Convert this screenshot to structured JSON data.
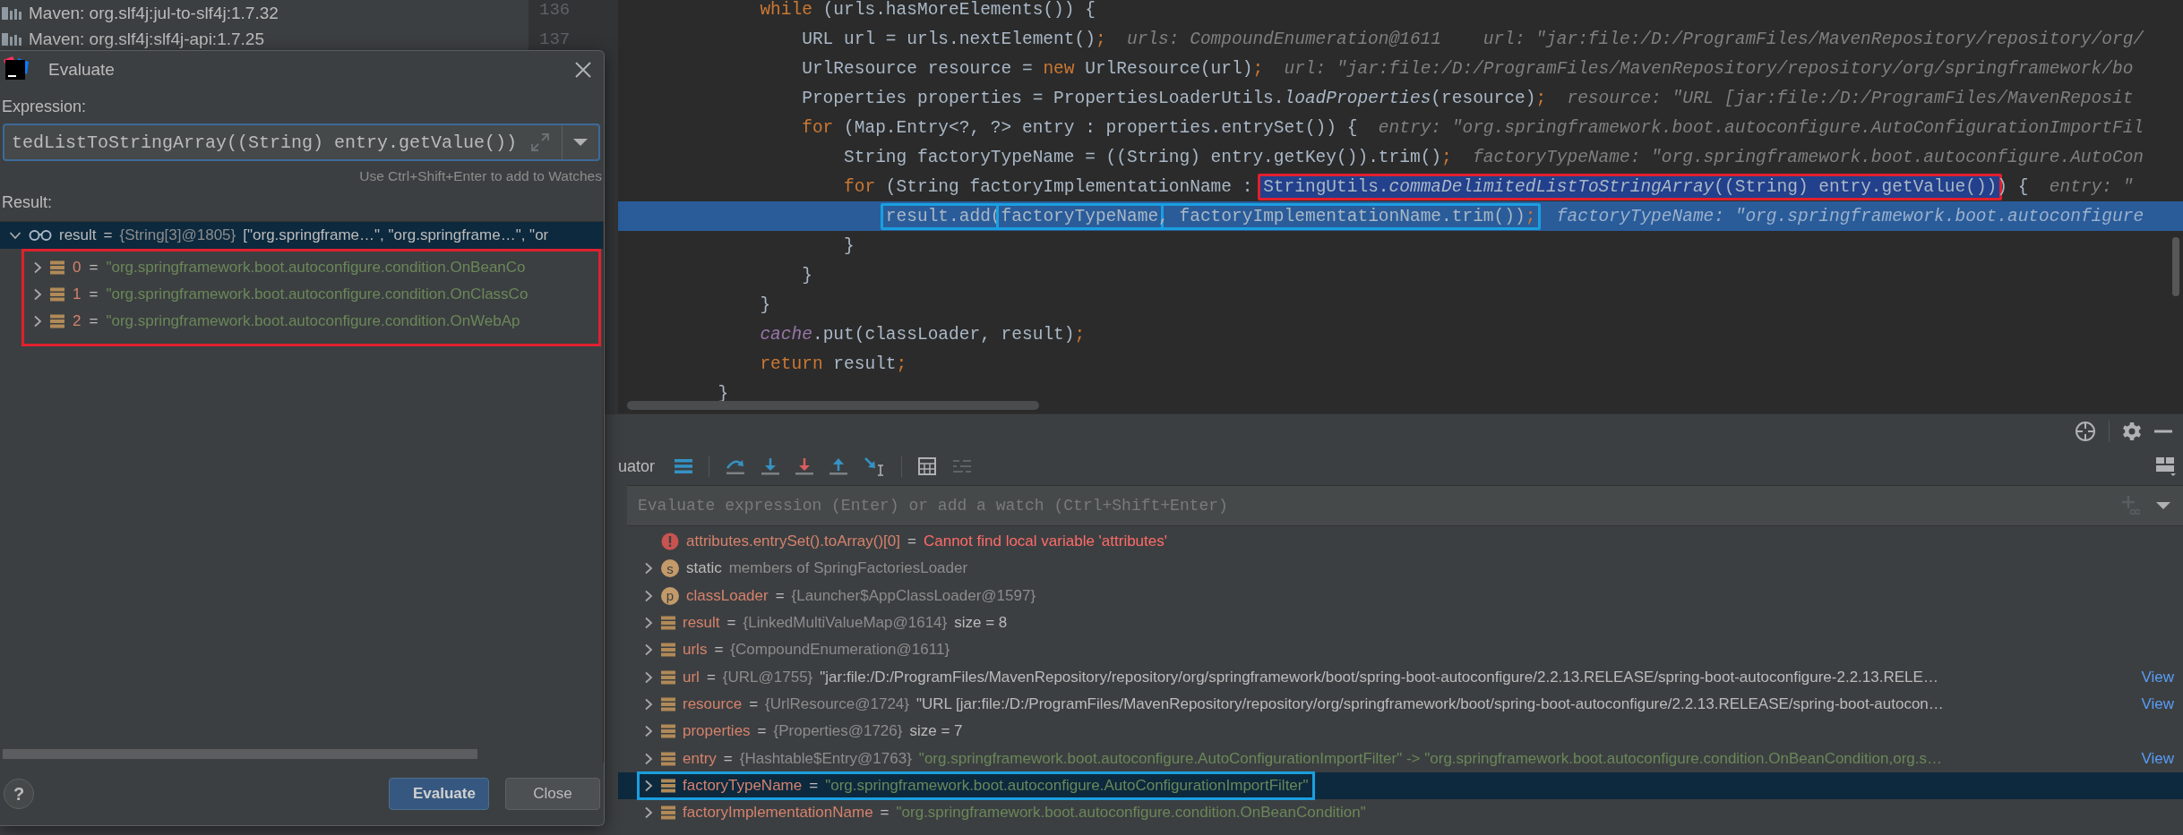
{
  "project_tree": {
    "items": [
      {
        "label": "Maven: org.slf4j:jul-to-slf4j:1.7.32"
      },
      {
        "label": "Maven: org.slf4j:slf4j-api:1.7.25"
      }
    ]
  },
  "editor": {
    "lines": [
      {
        "number": "136",
        "current": false,
        "code": [
          {
            "kind": "keyword",
            "text": "            while"
          },
          {
            "kind": "plain",
            "text": " (urls.hasMoreElements()) {"
          }
        ]
      },
      {
        "number": "137",
        "current": false,
        "code": [
          {
            "kind": "plain",
            "text": "                URL url = urls.nextElement()"
          },
          {
            "kind": "semicolon",
            "text": ";"
          }
        ],
        "hints": [
          "urls: CompoundEnumeration@1611",
          "url: \"jar:file:/D:/ProgramFiles/MavenRepository/repository/org/"
        ]
      },
      {
        "current": false,
        "code": [
          {
            "kind": "plain",
            "text": "                UrlResource resource = "
          },
          {
            "kind": "keyword",
            "text": "new"
          },
          {
            "kind": "plain",
            "text": " UrlResource(url)"
          },
          {
            "kind": "semicolon",
            "text": ";"
          }
        ],
        "hints": [
          "url: \"jar:file:/D:/ProgramFiles/MavenRepository/repository/org/springframework/bo"
        ]
      },
      {
        "current": false,
        "code": [
          {
            "kind": "plain",
            "text": "                Properties properties = PropertiesLoaderUtils."
          },
          {
            "kind": "italic",
            "text": "loadProperties"
          },
          {
            "kind": "plain",
            "text": "(resource)"
          },
          {
            "kind": "semicolon",
            "text": ";"
          }
        ],
        "hints": [
          "resource: \"URL [jar:file:/D:/ProgramFiles/MavenReposit"
        ]
      },
      {
        "current": false,
        "code": [
          {
            "kind": "keyword",
            "text": "                for"
          },
          {
            "kind": "plain",
            "text": " (Map.Entry<?, ?> entry : properties.entrySet()) {"
          }
        ],
        "hints": [
          "entry: \"org.springframework.boot.autoconfigure.AutoConfigurationImportFil"
        ]
      },
      {
        "current": false,
        "code": [
          {
            "kind": "plain",
            "text": "                    String factoryTypeName = ((String) entry.getKey()).trim()"
          },
          {
            "kind": "semicolon",
            "text": ";"
          }
        ],
        "hints": [
          "factoryTypeName: \"org.springframework.boot.autoconfigure.AutoCon"
        ]
      },
      {
        "current": false,
        "code": [
          {
            "kind": "keyword",
            "text": "                    for"
          },
          {
            "kind": "plain",
            "text": " (String factoryImplementationName : "
          },
          {
            "kind": "box",
            "color": "#e0202e",
            "selected": true,
            "tokens": [
              {
                "kind": "plain",
                "text": "StringUtils."
              },
              {
                "kind": "italic",
                "text": "commaDelimitedListToStringArray"
              },
              {
                "kind": "plain",
                "text": "((String) entry.getValue())"
              }
            ]
          },
          {
            "kind": "plain",
            "text": ") {"
          }
        ],
        "hints": [
          "entry: \""
        ]
      },
      {
        "current": true,
        "code": [
          {
            "kind": "box",
            "color": "#1a9fe0",
            "selected": false,
            "tokens": [
              {
                "kind": "plain",
                "text": "                        result.add("
              },
              {
                "kind": "box",
                "color": "#1a9fe0",
                "selected": false,
                "tokens": [
                  {
                    "kind": "plain",
                    "text": "factoryTypeName"
                  }
                ]
              },
              {
                "kind": "plain",
                "text": ", factoryImplementationName.trim())"
              },
              {
                "kind": "semicolon",
                "text": ";"
              }
            ]
          }
        ],
        "hints": [
          "factoryTypeName: \"org.springframework.boot.autoconfigure"
        ]
      },
      {
        "current": false,
        "code": [
          {
            "kind": "plain",
            "text": "                    }"
          }
        ]
      },
      {
        "current": false,
        "code": [
          {
            "kind": "plain",
            "text": "                }"
          }
        ]
      },
      {
        "current": false,
        "code": [
          {
            "kind": "plain",
            "text": "            }"
          }
        ]
      },
      {
        "current": false,
        "code": [
          {
            "kind": "static_field",
            "text": "            cache"
          },
          {
            "kind": "plain",
            "text": ".put(classLoader, result)"
          },
          {
            "kind": "semicolon",
            "text": ";"
          }
        ]
      },
      {
        "current": false,
        "code": [
          {
            "kind": "keyword",
            "text": "            return"
          },
          {
            "kind": "plain",
            "text": " result"
          },
          {
            "kind": "semicolon",
            "text": ";"
          }
        ]
      },
      {
        "current": false,
        "code": [
          {
            "kind": "plain",
            "text": "        }"
          }
        ]
      }
    ]
  },
  "debugger": {
    "tab": "uator",
    "watch_field": {
      "placeholder": "Evaluate expression (Enter) or add a watch (Ctrl+Shift+Enter)"
    },
    "variables": [
      {
        "kind": "error",
        "name": "attributes.entrySet().toArray()[0]",
        "sign": "=",
        "value": "Cannot find local variable 'attributes'",
        "expandable": false,
        "selected": false,
        "boxed": false
      },
      {
        "kind": "static",
        "badge": "s",
        "name": "static",
        "value": "members of SpringFactoriesLoader",
        "expandable": true,
        "selected": false,
        "boxed": false
      },
      {
        "kind": "field",
        "badge": "p",
        "name": "classLoader",
        "sign": "=",
        "type": "{Launcher$AppClassLoader@1597}",
        "expandable": true,
        "selected": false,
        "boxed": false
      },
      {
        "kind": "local",
        "name": "result",
        "sign": "=",
        "type": "{LinkedMultiValueMap@1614}",
        "value": "size = 8",
        "is_string": false,
        "expandable": true,
        "selected": false,
        "boxed": false
      },
      {
        "kind": "local",
        "name": "urls",
        "sign": "=",
        "type": "{CompoundEnumeration@1611}",
        "expandable": true,
        "selected": false,
        "boxed": false
      },
      {
        "kind": "local",
        "name": "url",
        "sign": "=",
        "type": "{URL@1755}",
        "value": "\"jar:file:/D:/ProgramFiles/MavenRepository/repository/org/springframework/boot/spring-boot-autoconfigure/2.2.13.RELEASE/spring-boot-autoconfigure-2.2.13.RELE…",
        "is_string": false,
        "link": "View",
        "expandable": true,
        "selected": false,
        "boxed": false
      },
      {
        "kind": "local",
        "name": "resource",
        "sign": "=",
        "type": "{UrlResource@1724}",
        "value": "\"URL [jar:file:/D:/ProgramFiles/MavenRepository/repository/org/springframework/boot/spring-boot-autoconfigure/2.2.13.RELEASE/spring-boot-autocon…",
        "is_string": false,
        "link": "View",
        "expandable": true,
        "selected": false,
        "boxed": false
      },
      {
        "kind": "local",
        "name": "properties",
        "sign": "=",
        "type": "{Properties@1726}",
        "value": "size = 7",
        "is_string": false,
        "expandable": true,
        "selected": false,
        "boxed": false
      },
      {
        "kind": "local",
        "name": "entry",
        "sign": "=",
        "type": "{Hashtable$Entry@1763}",
        "value": "\"org.springframework.boot.autoconfigure.AutoConfigurationImportFilter\" -> \"org.springframework.boot.autoconfigure.condition.OnBeanCondition,org.s…",
        "is_string": true,
        "link": "View",
        "expandable": true,
        "selected": false,
        "boxed": false
      },
      {
        "kind": "local",
        "name": "factoryTypeName",
        "sign": "=",
        "value": "\"org.springframework.boot.autoconfigure.AutoConfigurationImportFilter\"",
        "is_string": true,
        "expandable": true,
        "selected": true,
        "boxed": true
      },
      {
        "kind": "local",
        "name": "factoryImplementationName",
        "sign": "=",
        "value": "\"org.springframework.boot.autoconfigure.condition.OnBeanCondition\"",
        "is_string": true,
        "expandable": true,
        "selected": false,
        "boxed": false
      }
    ]
  },
  "dialog": {
    "title": "Evaluate",
    "expression_label": "Expression:",
    "expression": {
      "value": "tedListToStringArray((String) entry.getValue())"
    },
    "hint": "Use Ctrl+Shift+Enter to add to Watches",
    "result_label": "Result:",
    "result": {
      "name": "result",
      "sign": "=",
      "type": "{String[3]@1805}",
      "value": "[\"org.springframe…\", \"org.springframe…\", \"or",
      "expanded": true,
      "selected": true,
      "children": [
        {
          "name": "0",
          "sign": "=",
          "value": "\"org.springframework.boot.autoconfigure.condition.OnBeanCo",
          "expandable": true,
          "selected": false
        },
        {
          "name": "1",
          "sign": "=",
          "value": "\"org.springframework.boot.autoconfigure.condition.OnClassCo",
          "expandable": true,
          "selected": false
        },
        {
          "name": "2",
          "sign": "=",
          "value": "\"org.springframework.boot.autoconfigure.condition.OnWebAp",
          "expandable": true,
          "selected": false
        }
      ]
    },
    "help": "?",
    "buttons": [
      {
        "label": "Evaluate",
        "default": true
      },
      {
        "label": "Close",
        "default": false
      }
    ]
  }
}
